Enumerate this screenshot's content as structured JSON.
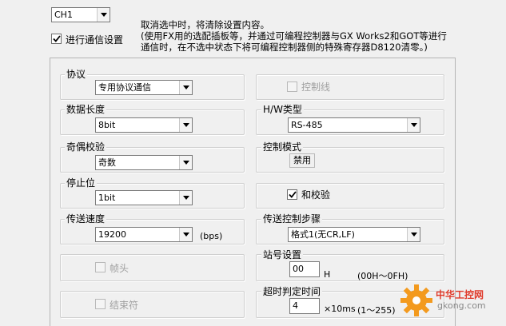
{
  "channel": {
    "value": "CH1"
  },
  "comm_settings": {
    "label": "进行通信设置",
    "checked": true
  },
  "note": {
    "line1": "取消选中时，将清除设置内容。",
    "line2": "(使用FX用的选配插板等，并通过可编程控制器与GX Works2和GOT等进行",
    "line3": "通信时，在不选中状态下将可编程控制器侧的特殊寄存器D8120清零。)"
  },
  "protocol": {
    "title": "协议",
    "value": "专用协议通信"
  },
  "control_line": {
    "label": "控制线",
    "checked": false,
    "enabled": false
  },
  "data_length": {
    "title": "数据长度",
    "value": "8bit"
  },
  "hw_type": {
    "title": "H/W类型",
    "value": "RS-485"
  },
  "parity": {
    "title": "奇偶校验",
    "value": "奇数"
  },
  "control_mode": {
    "title": "控制模式",
    "value": "禁用"
  },
  "stop_bit": {
    "title": "停止位",
    "value": "1bit"
  },
  "sum_check": {
    "label": "和校验",
    "checked": true
  },
  "baud_rate": {
    "title": "传送速度",
    "value": "19200",
    "unit": "(bps)"
  },
  "transmission_procedure": {
    "title": "传送控制步骤",
    "value": "格式1(无CR,LF)"
  },
  "header": {
    "label": "帧头",
    "checked": false,
    "enabled": false
  },
  "station_number": {
    "title": "站号设置",
    "value": "00",
    "unit": "H",
    "range": "(00H～0FH)"
  },
  "terminator": {
    "label": "结束符",
    "checked": false,
    "enabled": false
  },
  "timeout": {
    "title": "超时判定时间",
    "value": "4",
    "unit": "×10ms",
    "range": "(1～255)"
  },
  "watermark": {
    "line1": "中华工控网",
    "line2": "gkong.com"
  },
  "colors": {
    "accent_orange": "#f39a1e",
    "watermark_red": "#e03a2a"
  }
}
